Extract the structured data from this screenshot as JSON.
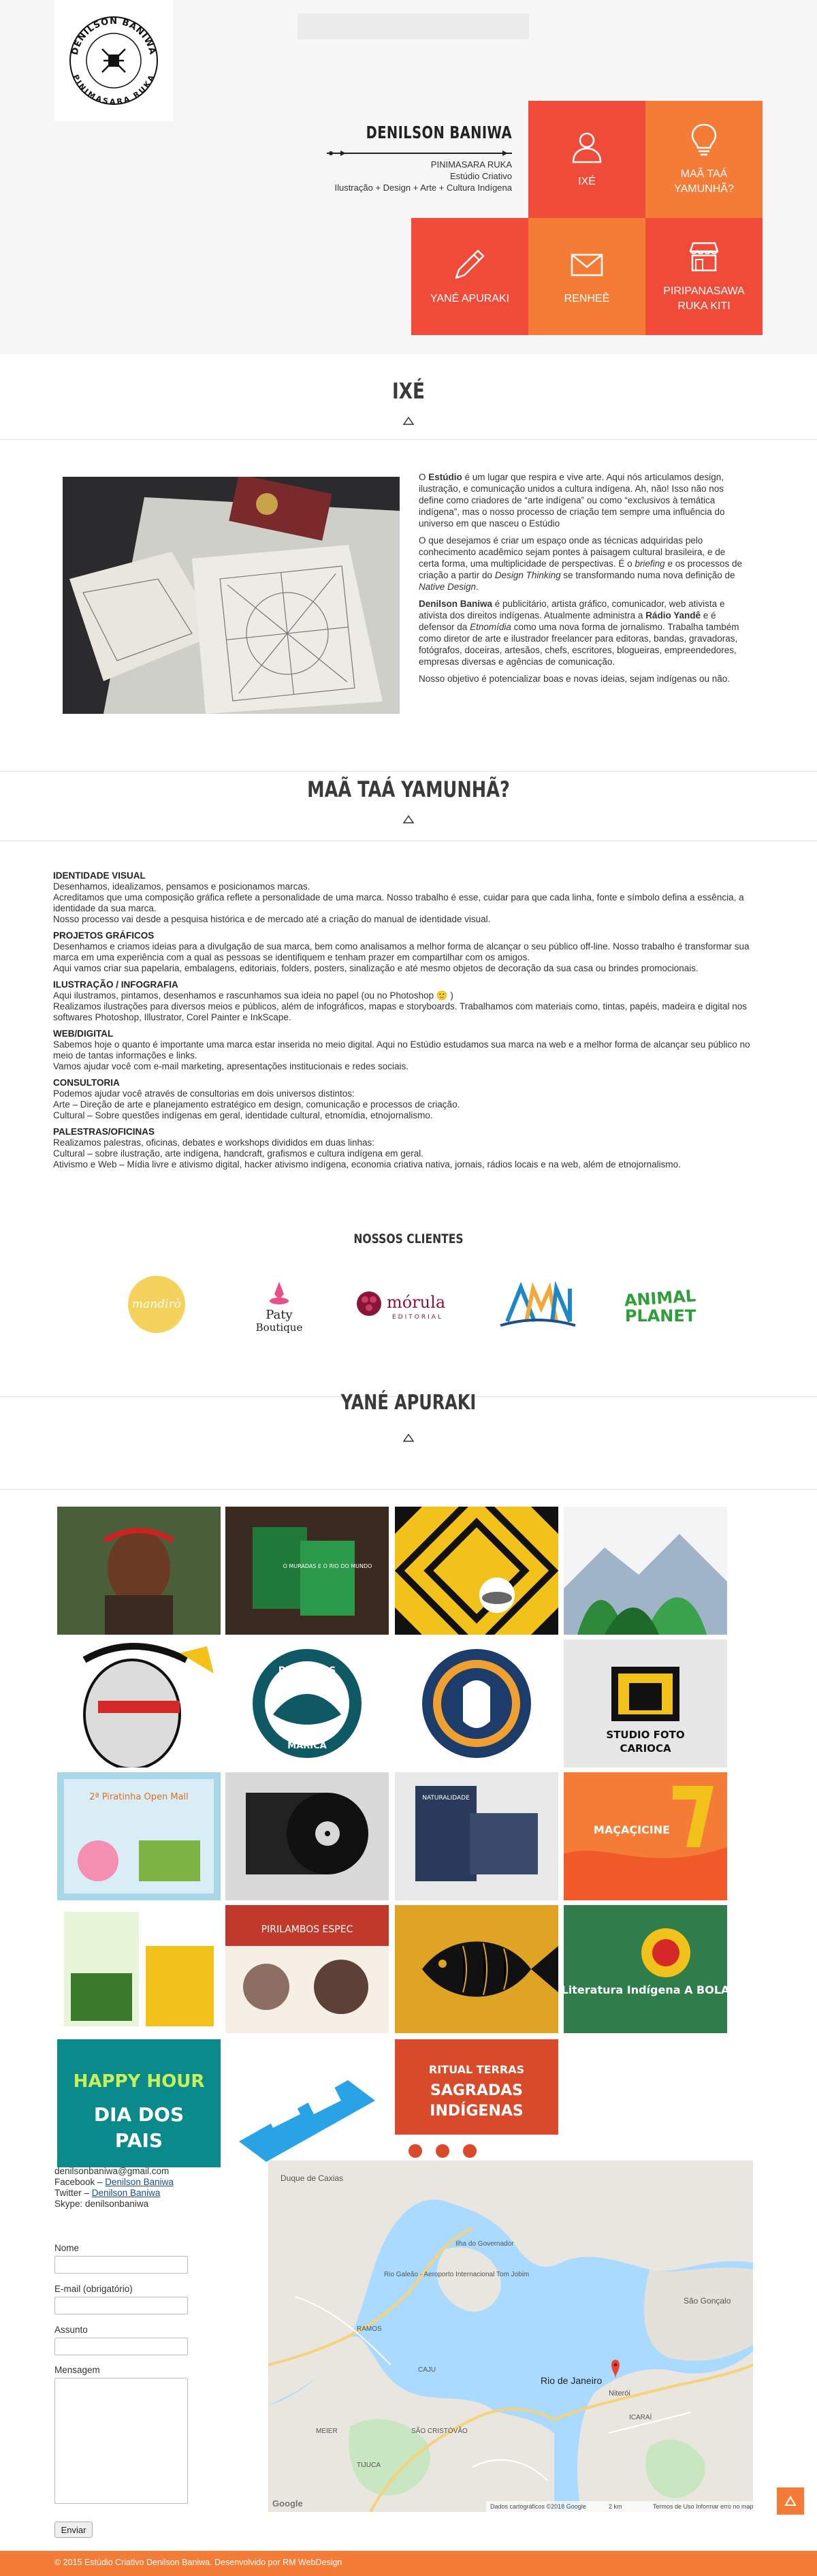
{
  "header": {
    "logo_lines": [
      "DENILSON BANIWA",
      "PINIMASARA RUKA"
    ],
    "brand_name": "DENILSON BANIWA",
    "subtitle_1": "PINIMASARA RUKA",
    "subtitle_2": "Estúdio Criativo",
    "subtitle_3": "Ilustração + Design + Arte + Cultura Indígena"
  },
  "nav_tiles": [
    {
      "label": "IXÉ",
      "icon": "user-icon",
      "color": "#f04b39"
    },
    {
      "label": "MAÃ TAÁ YAMUNHÃ?",
      "icon": "lightbulb-icon",
      "color": "#f47c37"
    },
    {
      "label": "YANÉ APURAKI",
      "icon": "pencil-icon",
      "color": "#f04b39"
    },
    {
      "label": "RENHEÊ",
      "icon": "envelope-icon",
      "color": "#f47c37"
    },
    {
      "label": "PIRIPANASAWA RUKA KITI",
      "icon": "store-icon",
      "color": "#f04b39"
    }
  ],
  "ixe": {
    "title": "IXÉ",
    "p1_pre": "O ",
    "p1_bold": "Estúdio",
    "p1_post": " é um lugar que respira e vive arte. Aqui nós articulamos design, ilustração, e comunicação unidos a cultura indígena. Ah, não! Isso não nos define como criadores de “arte indígena” ou como “exclusivos à temática indígena”, mas o nosso processo de criação tem sempre uma influência do universo em que nasceu o Estúdio",
    "p2_a": "O que desejamos é criar um espaço onde as técnicas adquiridas pelo conhecimento acadêmico sejam pontes à paisagem cultural brasileira, e de certa forma, uma multiplicidade de perspectivas. É o ",
    "p2_i1": "briefing",
    "p2_b": " e os processos de criação a partir do ",
    "p2_i2": "Design Thinking",
    "p2_c": " se transformando numa nova definição de ",
    "p2_i3": "Native Design",
    "p2_d": ".",
    "p3_bold": "Denilson Baniwa",
    "p3_a": " é publicitário, artista gráfico, comunicador, web ativista e ativista dos direitos indígenas. Atualmente administra a ",
    "p3_bold2": "Rádio Yandê",
    "p3_b": " e é defensor da ",
    "p3_i": "Etnomídia",
    "p3_c": " como uma nova forma de jornalismo. Trabalha também como diretor de arte e ilustrador freelancer para editoras, bandas, gravadoras, fotógrafos, doceiras, artesãos, chefs, escritores, blogueiras, empreendedores, empresas diversas e agências de comunicação.",
    "p4": "Nosso objetivo é potencializar boas e novas ideias, sejam indígenas ou não."
  },
  "maa": {
    "title": "MAÃ TAÁ YAMUNHÃ?",
    "services": [
      {
        "title": "IDENTIDADE VISUAL",
        "lines": [
          "Desenhamos, idealizamos, pensamos e posicionamos marcas.",
          "Acreditamos que uma composição gráfica reflete a personalidade de uma marca. Nosso trabalho é esse, cuidar para que cada linha, fonte e símbolo defina a essência, a identidade da sua marca.",
          "Nosso processo vai desde a pesquisa histórica e de mercado até a criação do manual de identidade visual."
        ]
      },
      {
        "title": "PROJETOS GRÁFICOS",
        "lines": [
          "Desenhamos e criamos ideias para a divulgação de sua marca, bem como analisamos a melhor forma de alcançar o seu público off-line. Nosso trabalho é transformar sua marca em uma experiência com a qual as pessoas se identifiquem e tenham prazer em compartilhar com os amigos.",
          "Aqui vamos criar sua papelaria, embalagens, editoriais, folders, posters, sinalização e até mesmo objetos de decoração da sua casa ou brindes promocionais."
        ]
      },
      {
        "title": "ILUSTRAÇÃO / INFOGRAFIA",
        "lines": [
          "Aqui ilustramos, pintamos, desenhamos e rascunhamos sua ideia no papel (ou no Photoshop 🙂 )",
          "Realizamos ilustrações para diversos meios e públicos, além de infográficos, mapas e storyboards. Trabalhamos com materiais como, tintas, papéis, madeira e digital nos softwares Photoshop, Illustrator, Corel Painter e InkScape."
        ]
      },
      {
        "title": "WEB/DIGITAL",
        "lines": [
          "Sabemos hoje o quanto é importante uma marca estar inserida no meio digital. Aqui no Estúdio estudamos sua marca na web e a melhor forma de alcançar seu público no meio de tantas informações e links.",
          "Vamos ajudar você com e-mail marketing, apresentações institucionais e redes sociais."
        ]
      },
      {
        "title": "CONSULTORIA",
        "lines": [
          "Podemos ajudar você através de consultorias em dois universos distintos:",
          "Arte – Direção de arte e planejamento estratégico em design, comunicação e processos de criação.",
          "Cultural – Sobre questões indígenas em geral, identidade cultural, etnomídia, etnojornalismo."
        ]
      },
      {
        "title": "PALESTRAS/OFICINAS",
        "lines": [
          "Realizamos palestras, oficinas, debates e workshops divididos em duas linhas:",
          "Cultural – sobre ilustração, arte indígena, handcraft, grafismos e cultura indígena em geral.",
          "Ativismo e Web – Mídia livre e ativismo digital, hacker ativismo indígena, economia criativa nativa, jornais, rádios locais e na web, além de etnojornalismo."
        ]
      }
    ]
  },
  "clients": {
    "title": "NOSSOS CLIENTES",
    "logos": [
      {
        "name": "mandirò",
        "color": "#f2c94c"
      },
      {
        "name": "Paty Boutique",
        "color": "#e94f8a"
      },
      {
        "name": "mórula",
        "sub": "EDITORIAL",
        "color": "#8a1538"
      },
      {
        "name": "AMN",
        "color": "#1e88c7"
      },
      {
        "name": "ANIMAL PLANET",
        "color": "#2e9e3a"
      }
    ]
  },
  "yane": {
    "title": "YANÉ APURAKI",
    "items": [
      {
        "caption": ""
      },
      {
        "caption": "O MURADAS E O RIO DO MUNDO"
      },
      {
        "caption": ""
      },
      {
        "caption": ""
      },
      {
        "caption": ""
      },
      {
        "caption": "PESCADOS MARICÁ"
      },
      {
        "caption": ""
      },
      {
        "caption": "STUDIO FOTO CARIOCA"
      },
      {
        "caption": "2ª Piratinha Open Mall"
      },
      {
        "caption": ""
      },
      {
        "caption": "NATURALIDADE"
      },
      {
        "caption": "MAÇAÇICINE"
      },
      {
        "caption": ""
      },
      {
        "caption": "PIRILAMBOS ESPEC"
      },
      {
        "caption": ""
      },
      {
        "caption": "Literatura Indígena A BOLA"
      },
      {
        "caption": "HAPPY HOUR DIA DOS PAIS"
      },
      {
        "caption": ""
      },
      {
        "caption": "RITUAL TERRAS SAGRADAS INDÍGENAS"
      }
    ]
  },
  "contact": {
    "email": "denilsonbaniwa@gmail.com",
    "facebook_prefix": "Facebook – ",
    "facebook_link": "Denilson Baniwa",
    "twitter_prefix": "Twitter – ",
    "twitter_link": "Denilson Baniwa",
    "skype": "Skype: denilsonbaniwa",
    "form": {
      "name_label": "Nome",
      "email_label": "E-mail (obrigatório)",
      "subject_label": "Assunto",
      "message_label": "Mensagem",
      "submit": "Enviar"
    }
  },
  "map": {
    "places": [
      "Duque de Caxias",
      "Ilha do Governador",
      "Rio Galeão - Aeroporto Internacional Tom Jobim",
      "São Gonçalo",
      "Niterói",
      "Rio de Janeiro",
      "RAMOS",
      "CAJU",
      "SÃO CRISTÓVÃO",
      "ICARAÍ",
      "MEIER",
      "TIJUCA"
    ],
    "brand": "Google",
    "attribution": "Dados cartográficos ©2018 Google",
    "scale": "2 km",
    "terms": "Termos de Uso",
    "report": "Informar erro no mapa"
  },
  "footer": {
    "text": "© 2015 Estúdio Criativo Denilson Baniwa. Desenvolvido por RM WebDesign"
  }
}
